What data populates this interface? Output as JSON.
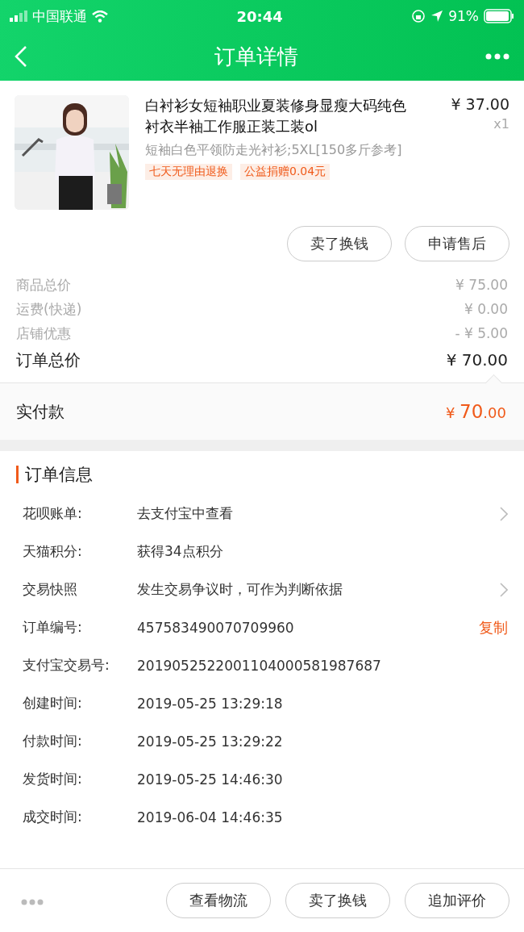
{
  "status_bar": {
    "carrier": "中国联通",
    "time": "20:44",
    "battery": "91%"
  },
  "nav": {
    "title": "订单详情"
  },
  "product": {
    "kind": "picture",
    "title": "白衬衫女短袖职业夏装修身显瘦大码纯色衬衣半袖工作服正装工装ol",
    "price": "¥ 37.00",
    "quantity": "x1",
    "sku": "短袖白色平领防走光衬衫;5XL[150多斤参考]",
    "tags": [
      "七天无理由退换",
      "公益捐赠0.04元"
    ],
    "buttons": [
      "卖了换钱",
      "申请售后"
    ]
  },
  "summary": [
    {
      "label": "商品总价",
      "value": "¥ 75.00"
    },
    {
      "label": "运费(快递)",
      "value": "¥ 0.00"
    },
    {
      "label": "店铺优惠",
      "value": "- ¥ 5.00"
    }
  ],
  "total": {
    "label": "订单总价",
    "value": "¥ 70.00"
  },
  "paid": {
    "label": "实付款",
    "currency": "¥",
    "amount": "70",
    "decimals": ".00"
  },
  "order_info": {
    "title": "订单信息",
    "rows": [
      {
        "label": "花呗账单:",
        "value": "去支付宝中查看",
        "kind": "link"
      },
      {
        "label": "天猫积分:",
        "value": "获得34点积分",
        "kind": "plain"
      },
      {
        "label": "交易快照",
        "value": "发生交易争议时，可作为判断依据",
        "kind": "link"
      },
      {
        "label": "订单编号:",
        "value": "457583490070709960",
        "kind": "copy",
        "action": "复制"
      },
      {
        "label": "支付宝交易号:",
        "value": "2019052522001104000581987687",
        "kind": "plain"
      },
      {
        "label": "创建时间:",
        "value": "2019-05-25 13:29:18",
        "kind": "plain"
      },
      {
        "label": "付款时间:",
        "value": "2019-05-25 13:29:22",
        "kind": "plain"
      },
      {
        "label": "发货时间:",
        "value": "2019-05-25 14:46:30",
        "kind": "plain"
      },
      {
        "label": "成交时间:",
        "value": "2019-06-04 14:46:35",
        "kind": "plain"
      }
    ]
  },
  "bottom_bar": {
    "buttons": [
      "查看物流",
      "卖了换钱",
      "追加评价"
    ]
  }
}
